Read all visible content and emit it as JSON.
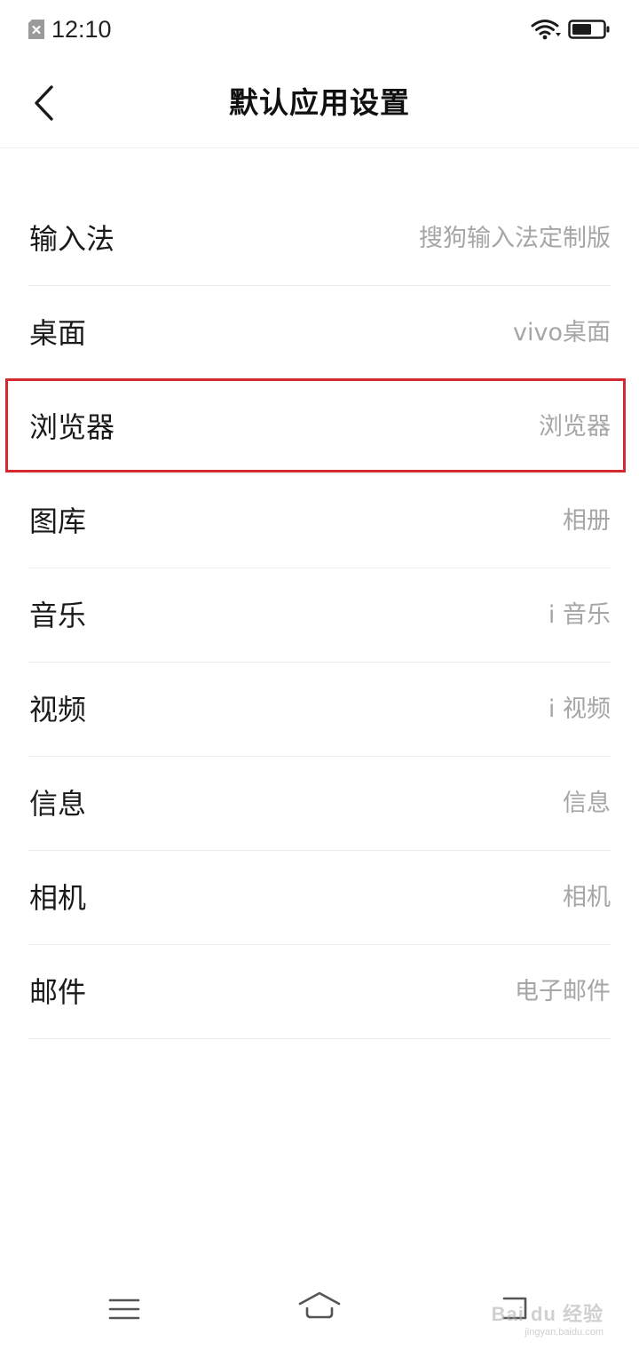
{
  "status_bar": {
    "time": "12:10",
    "icons": [
      "sim-card-icon",
      "wifi-icon",
      "battery-icon"
    ]
  },
  "header": {
    "title": "默认应用设置",
    "back_icon": "chevron-left-icon"
  },
  "settings": [
    {
      "label": "输入法",
      "value": "搜狗输入法定制版"
    },
    {
      "label": "桌面",
      "value": "vivo桌面"
    },
    {
      "label": "浏览器",
      "value": "浏览器"
    },
    {
      "label": "图库",
      "value": "相册"
    },
    {
      "label": "音乐",
      "value": "i 音乐"
    },
    {
      "label": "视频",
      "value": "i 视频"
    },
    {
      "label": "信息",
      "value": "信息"
    },
    {
      "label": "相机",
      "value": "相机"
    },
    {
      "label": "邮件",
      "value": "电子邮件"
    }
  ],
  "highlight": {
    "item": "浏览器",
    "color": "#d42a2f"
  },
  "nav_bar": {
    "icons": [
      "menu-icon",
      "home-icon",
      "back-icon"
    ]
  },
  "watermark": {
    "text": "Bai du 经验",
    "sub": "jingyan.baidu.com"
  },
  "colors": {
    "background": "#ffffff",
    "primary_text": "#1a1a1a",
    "secondary_text": "#a6a6a6",
    "divider": "#ececec"
  }
}
